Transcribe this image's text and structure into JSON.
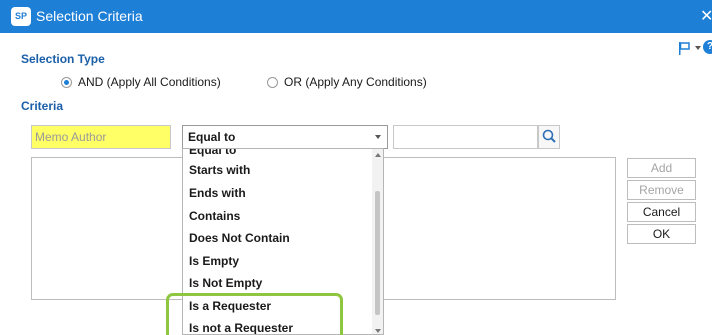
{
  "window": {
    "title": "Selection Criteria",
    "close_glyph": "✕"
  },
  "app_icon_text": "SP",
  "toolbar": {
    "icons": [
      "flag-icon",
      "chevron-down-icon",
      "help-icon"
    ],
    "help_glyph": "?"
  },
  "selection_type": {
    "label": "Selection Type",
    "options": [
      {
        "label": "AND (Apply All Conditions)",
        "checked": true
      },
      {
        "label": "OR (Apply Any Conditions)",
        "checked": false
      }
    ]
  },
  "criteria": {
    "label": "Criteria",
    "field_placeholder": "Memo Author",
    "operator_selected": "Equal to",
    "value": ""
  },
  "dropdown": {
    "partial_item": "Equal to",
    "items": [
      "Starts with",
      "Ends with",
      "Contains",
      "Does Not Contain",
      "Is Empty",
      "Is Not Empty",
      "Is a Requester",
      "Is not a Requester"
    ]
  },
  "buttons": {
    "add": "Add",
    "remove": "Remove",
    "cancel": "Cancel",
    "ok": "OK"
  },
  "colors": {
    "titlebar": "#1e7fd6",
    "section_label": "#1a5fa8",
    "field_highlight": "#ffff66",
    "annotation": "#8ec63f"
  }
}
